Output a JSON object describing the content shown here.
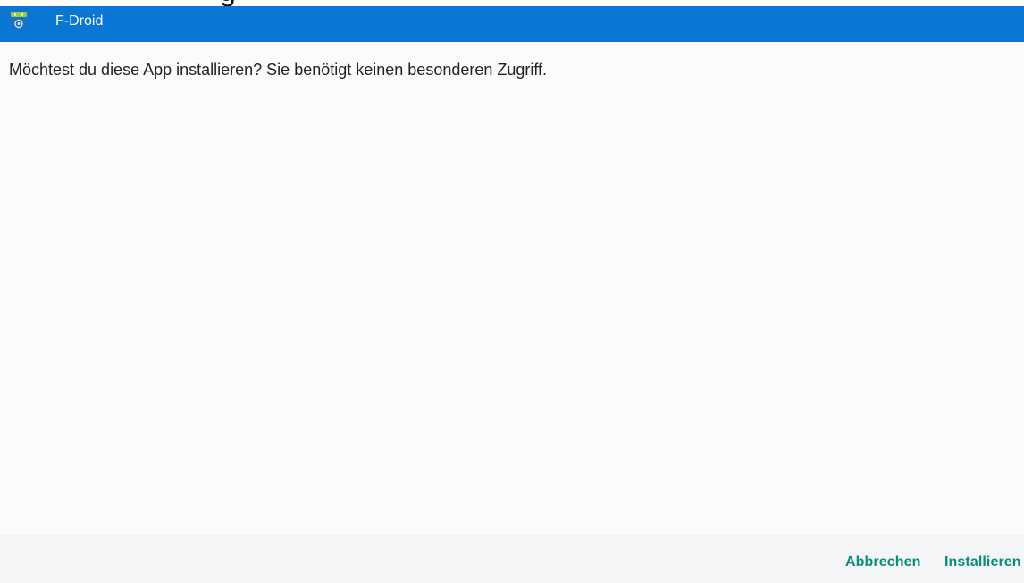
{
  "window": {
    "app_title": "F-Droid",
    "icon": "f-droid-app-icon"
  },
  "dialog": {
    "message": "Möchtest du diese App installieren? Sie benötigt keinen besonderen Zugriff.",
    "cancel_label": "Abbrechen",
    "install_label": "Installieren"
  },
  "colors": {
    "titlebar": "#0a77d5",
    "accent": "#0c8a7a",
    "content_bg": "#fbfbfc",
    "button_bar_bg": "#f4f5f6"
  }
}
